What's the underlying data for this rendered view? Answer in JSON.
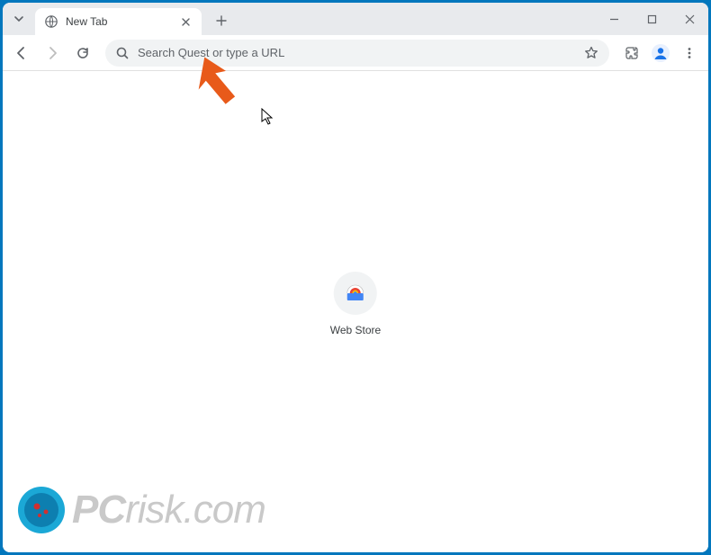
{
  "tab": {
    "title": "New Tab"
  },
  "omnibox": {
    "placeholder": "Search Quest or type a URL",
    "value": ""
  },
  "shortcuts": [
    {
      "label": "Web Store"
    }
  ],
  "watermark": {
    "prefix": "PC",
    "suffix": "risk.com"
  }
}
